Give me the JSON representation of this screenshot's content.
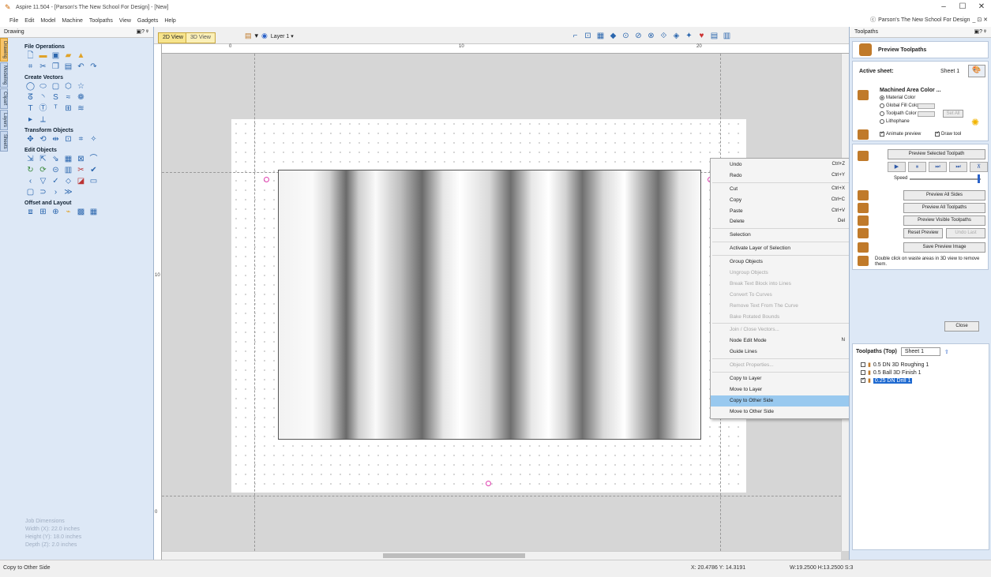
{
  "window": {
    "title": "Aspire 11.504 - [Parson's The New School For Design] - [New]",
    "minimize": "–",
    "maximize": "☐",
    "close": "✕"
  },
  "menu": [
    "File",
    "Edit",
    "Model",
    "Machine",
    "Toolpaths",
    "View",
    "Gadgets",
    "Help"
  ],
  "user_area": {
    "label": "Parson's The New School For Design",
    "controls": "_ ⊡ ✕"
  },
  "left_panel": {
    "title": "Drawing",
    "pin": "▣? ᵠ",
    "tabs": [
      "Drawing",
      "Modeling",
      "Clipart",
      "Layers",
      "Sheets"
    ],
    "sections": {
      "file_ops": "File Operations",
      "create_vectors": "Create Vectors",
      "transform": "Transform Objects",
      "edit": "Edit Objects",
      "offset": "Offset and Layout"
    },
    "job": {
      "title": "Job Dimensions",
      "width": "Width  (X): 22.0 inches",
      "height": "Height (Y): 18.0 inches",
      "depth": "Depth  (Z): 2.0 inches"
    }
  },
  "view": {
    "tab_2d": "2D View",
    "tab_3d": "3D View",
    "layer": "Layer 1 ▾",
    "ruler_ticks": [
      "0",
      "10",
      "20",
      "0",
      "10"
    ]
  },
  "context_menu": {
    "items": [
      {
        "label": "Undo",
        "shortcut": "Ctrl+Z",
        "disabled": false
      },
      {
        "label": "Redo",
        "shortcut": "Ctrl+Y",
        "disabled": false
      },
      {
        "sep": true
      },
      {
        "label": "Cut",
        "shortcut": "Ctrl+X",
        "disabled": false
      },
      {
        "label": "Copy",
        "shortcut": "Ctrl+C",
        "disabled": false
      },
      {
        "label": "Paste",
        "shortcut": "Ctrl+V",
        "disabled": false
      },
      {
        "label": "Delete",
        "shortcut": "Del",
        "disabled": false
      },
      {
        "sep": true
      },
      {
        "label": "Selection",
        "arrow": true,
        "disabled": false
      },
      {
        "sep": true
      },
      {
        "label": "Activate Layer of Selection",
        "disabled": false
      },
      {
        "sep": true
      },
      {
        "label": "Group Objects",
        "disabled": false
      },
      {
        "label": "Ungroup Objects",
        "arrow": true,
        "disabled": true
      },
      {
        "label": "Break Text Block into Lines",
        "disabled": true
      },
      {
        "label": "Convert To Curves",
        "disabled": true
      },
      {
        "label": "Remove Text From The Curve",
        "disabled": true
      },
      {
        "label": "Bake Rotated Bounds",
        "disabled": true
      },
      {
        "sep": true
      },
      {
        "label": "Join / Close Vectors...",
        "disabled": true
      },
      {
        "label": "Node Edit Mode",
        "shortcut": "N",
        "disabled": false
      },
      {
        "label": "Guide Lines",
        "arrow": true,
        "disabled": false
      },
      {
        "sep": true
      },
      {
        "label": "Object Properties...",
        "disabled": true
      },
      {
        "sep": true
      },
      {
        "label": "Copy to Layer",
        "arrow": true,
        "disabled": false
      },
      {
        "label": "Move to Layer",
        "arrow": true,
        "disabled": false
      },
      {
        "label": "Copy to Other Side",
        "disabled": false,
        "highlight": true
      },
      {
        "label": "Move to Other Side",
        "disabled": false
      }
    ]
  },
  "right_panel": {
    "title": "Toolpaths",
    "pin": "▣? ᵠ",
    "preview_title": "Preview Toolpaths",
    "active_sheet_label": "Active sheet:",
    "active_sheet_value": "Sheet 1",
    "machined_title": "Machined Area Color ...",
    "options": [
      "Material Color",
      "Global Fill Color",
      "Toolpath Color",
      "Lithophane"
    ],
    "selected_option": 0,
    "set_all": "Set All",
    "animate_preview": "Animate preview",
    "draw_tool": "Draw tool",
    "preview_selected": "Preview Selected Toolpath",
    "speed": "Speed",
    "speed_level": 1.0,
    "preview_all_sides": "Preview All Sides",
    "preview_all": "Preview All Toolpaths",
    "preview_visible": "Preview Visible Toolpaths",
    "reset": "Reset Preview",
    "undo_last": "Undo Last",
    "save_image": "Save Preview Image",
    "note": "Double click on waste areas in 3D view to remove them.",
    "close": "Close",
    "toolpaths_header": "Toolpaths (Top)",
    "toolpaths_sheet": "Sheet 1",
    "toolpaths": [
      {
        "label": "0.5 DN 3D Roughing 1",
        "checked": false,
        "selected": false
      },
      {
        "label": "0.5 Ball 3D Finish 1",
        "checked": false,
        "selected": false
      },
      {
        "label": "0.25 DN Drill 1",
        "checked": true,
        "selected": true
      }
    ]
  },
  "status": {
    "left": "Copy to Other Side",
    "coords": "X: 20.4786 Y: 14.3191",
    "dims": "W:19.2500  H:13.2500  S:3"
  }
}
